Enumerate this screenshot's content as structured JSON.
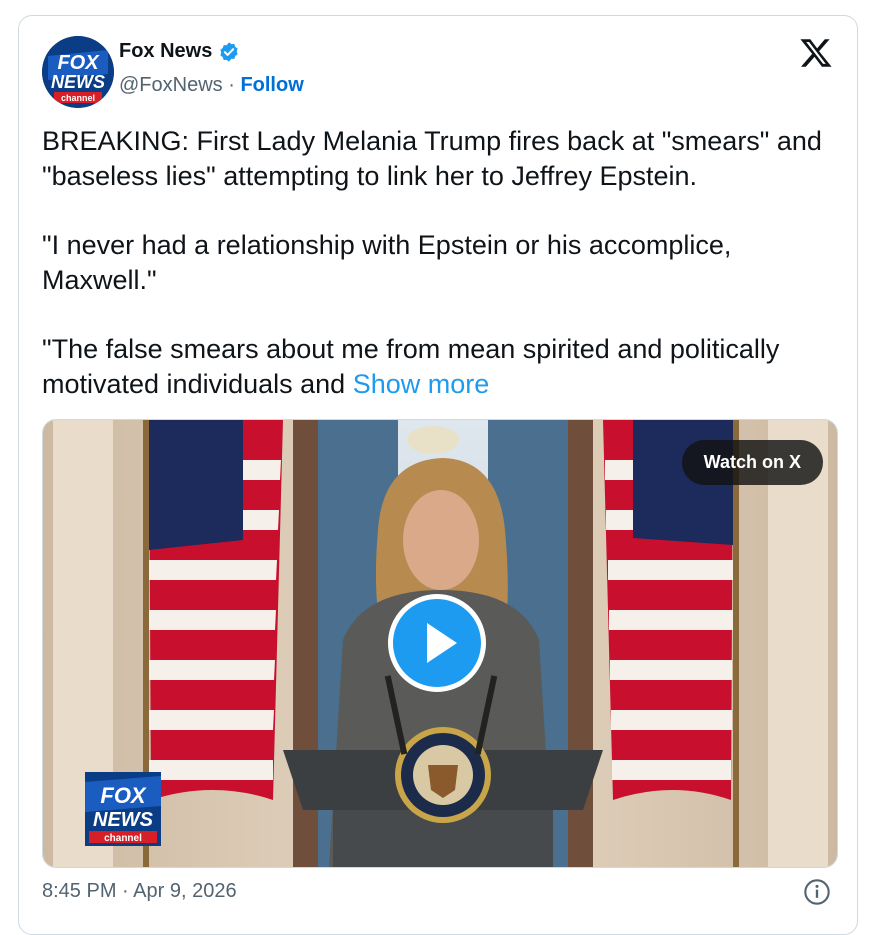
{
  "author": {
    "name": "Fox News",
    "handle": "@FoxNews",
    "separator": " · ",
    "follow_label": "Follow",
    "verified_icon": "verified-badge-icon",
    "avatar_logo": {
      "line1": "FOX",
      "line2": "NEWS",
      "line3": "channel"
    }
  },
  "platform_icon": "x-logo-icon",
  "tweet": {
    "para1": "BREAKING: First Lady Melania Trump fires back at \"smears\" and \"baseless lies\" attempting to link her to Jeffrey Epstein.",
    "para2": "\"I never had a relationship with Epstein or his accomplice, Maxwell.\"",
    "para3": "\"The false smears about me from mean spirited and politically motivated individuals and ",
    "show_more_label": "Show more"
  },
  "media": {
    "watch_label": "Watch on X",
    "play_icon": "play-icon",
    "bug_logo": {
      "line1": "FOX",
      "line2": "NEWS",
      "line3": "channel"
    }
  },
  "footer": {
    "timestamp": "8:45 PM · Apr 9, 2026",
    "info_icon": "info-icon"
  },
  "colors": {
    "link_blue": "#1d9bf0",
    "follow_blue": "#006fd6",
    "secondary_text": "#536471",
    "border": "#cfd9de"
  }
}
